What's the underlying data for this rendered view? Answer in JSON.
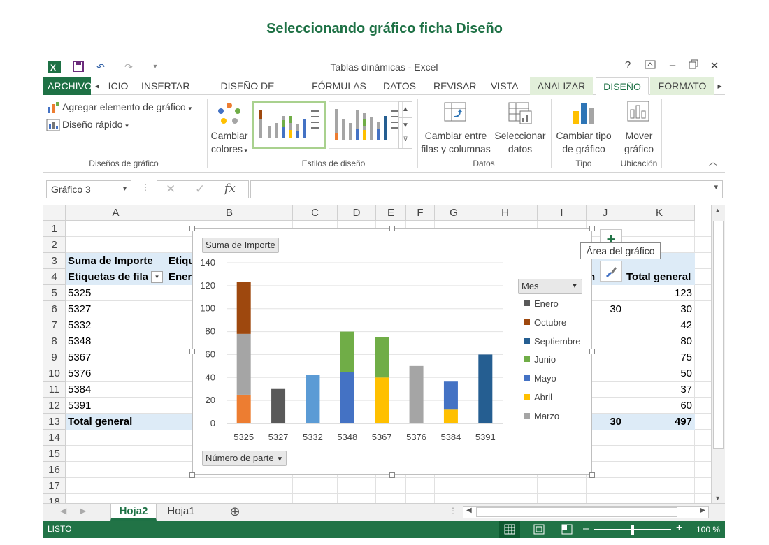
{
  "caption": "Seleccionando gráfico ficha Diseño",
  "window_title": "Tablas dinámicas - Excel",
  "tabs": {
    "file": "ARCHIVO",
    "inicio": "ICIO",
    "insertar": "INSERTAR",
    "diseno_pagina": "DISEÑO DE PÁGINA",
    "formulas": "FÓRMULAS",
    "datos": "DATOS",
    "revisar": "REVISAR",
    "vista": "VISTA",
    "analizar": "ANALIZAR",
    "diseno": "DISEÑO",
    "formato": "FORMATO"
  },
  "ribbon": {
    "add_element": "Agregar elemento de gráfico",
    "quick_layout": "Diseño rápido",
    "group_layouts": "Diseños de gráfico",
    "change_colors_1": "Cambiar",
    "change_colors_2": "colores",
    "group_styles": "Estilos de diseño",
    "switch_rowcol_1": "Cambiar entre",
    "switch_rowcol_2": "filas y columnas",
    "select_data_1": "Seleccionar",
    "select_data_2": "datos",
    "group_data": "Datos",
    "change_type_1": "Cambiar tipo",
    "change_type_2": "de gráfico",
    "group_type": "Tipo",
    "move_chart_1": "Mover",
    "move_chart_2": "gráfico",
    "group_location": "Ubicación"
  },
  "namebox": "Gráfico 3",
  "fx": "fx",
  "columns": [
    "A",
    "B",
    "C",
    "D",
    "E",
    "F",
    "G",
    "H",
    "I",
    "J",
    "K"
  ],
  "rows": [
    "1",
    "2",
    "3",
    "4",
    "5",
    "6",
    "7",
    "8",
    "9",
    "10",
    "11",
    "12",
    "13",
    "14",
    "15",
    "16",
    "17",
    "18"
  ],
  "cells": {
    "a3": "Suma de Importe",
    "b3": "Etiqu",
    "a4": "Etiquetas de fila",
    "b4": "Ener",
    "j4": "n",
    "k4": "Total general",
    "a5": "5325",
    "a6": "5327",
    "a7": "5332",
    "a8": "5348",
    "a9": "5367",
    "a10": "5376",
    "a11": "5384",
    "a12": "5391",
    "a13": "Total general",
    "j6": "30",
    "k5": "123",
    "k6": "30",
    "k7": "42",
    "k8": "80",
    "k9": "75",
    "k10": "50",
    "k11": "37",
    "k12": "60",
    "j13": "30",
    "k13": "497"
  },
  "chart_field_value": "Suma de Importe",
  "chart_field_axis": "Número de parte",
  "chart_field_legend": "Mes",
  "tooltip": "Área del gráfico",
  "sheets": [
    "Hoja2",
    "Hoja1"
  ],
  "status": {
    "ready": "LISTO",
    "zoom": "100 %"
  },
  "colors": {
    "excel_green": "#217346",
    "caption_green": "#1e7145"
  },
  "chart_data": {
    "type": "bar",
    "stacked": true,
    "categories": [
      "5325",
      "5327",
      "5332",
      "5348",
      "5367",
      "5376",
      "5384",
      "5391"
    ],
    "ylim": [
      0,
      140
    ],
    "yticks": [
      0,
      20,
      40,
      60,
      80,
      100,
      120,
      140
    ],
    "grid": true,
    "legend_position": "right",
    "series": [
      {
        "name": "Enero",
        "color": "#595959",
        "values": [
          0,
          30,
          0,
          0,
          0,
          0,
          0,
          0
        ]
      },
      {
        "name": "Octubre",
        "color": "#9e480e",
        "values": [
          45,
          0,
          0,
          0,
          0,
          0,
          0,
          0
        ]
      },
      {
        "name": "Septiembre",
        "color": "#255e91",
        "values": [
          0,
          0,
          0,
          0,
          0,
          0,
          0,
          60
        ]
      },
      {
        "name": "Junio",
        "color": "#70ad47",
        "values": [
          0,
          0,
          0,
          35,
          35,
          0,
          0,
          0
        ]
      },
      {
        "name": "Mayo",
        "color": "#4472c4",
        "values": [
          0,
          0,
          0,
          45,
          0,
          0,
          25,
          0
        ]
      },
      {
        "name": "Abril",
        "color": "#ffc000",
        "values": [
          0,
          0,
          0,
          0,
          40,
          0,
          12,
          0
        ]
      },
      {
        "name": "Marzo",
        "color": "#a5a5a5",
        "values": [
          53,
          0,
          0,
          0,
          0,
          50,
          0,
          0
        ]
      },
      {
        "name": "",
        "color": "#5b9bd5",
        "values": [
          0,
          0,
          42,
          0,
          0,
          0,
          0,
          0
        ]
      },
      {
        "name": "",
        "color": "#ed7d31",
        "values": [
          25,
          0,
          0,
          0,
          0,
          0,
          0,
          0
        ]
      }
    ]
  }
}
